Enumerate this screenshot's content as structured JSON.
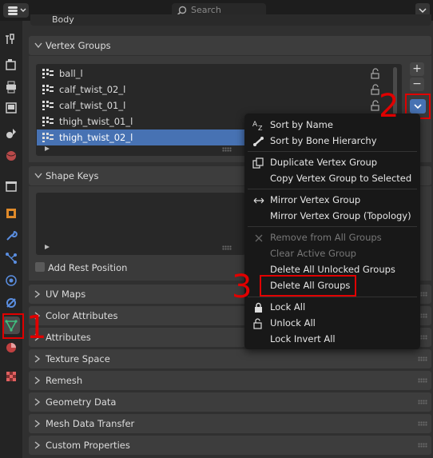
{
  "topbar": {
    "search_placeholder": "Search"
  },
  "header": {
    "object_name_partial": "Body"
  },
  "panels": {
    "vertex_groups": {
      "title": "Vertex Groups",
      "items": [
        {
          "label": "ball_l",
          "selected": false
        },
        {
          "label": "calf_twist_02_l",
          "selected": false
        },
        {
          "label": "calf_twist_01_l",
          "selected": false
        },
        {
          "label": "thigh_twist_01_l",
          "selected": false
        },
        {
          "label": "thigh_twist_02_l",
          "selected": true
        }
      ],
      "add_label": "+",
      "remove_label": "−"
    },
    "shape_keys": {
      "title": "Shape Keys",
      "add_rest_position": "Add Rest Position"
    },
    "collapsed": [
      "UV Maps",
      "Color Attributes",
      "Attributes",
      "Texture Space",
      "Remesh",
      "Geometry Data",
      "Mesh Data Transfer",
      "Custom Properties"
    ]
  },
  "context_menu": {
    "items": [
      {
        "label": "Sort by Name",
        "icon": "sort-alpha-icon",
        "enabled": true
      },
      {
        "label": "Sort by Bone Hierarchy",
        "icon": "bone-icon",
        "enabled": true
      },
      {
        "label": "Duplicate Vertex Group",
        "icon": "duplicate-icon",
        "enabled": true
      },
      {
        "label": "Copy Vertex Group to Selected",
        "icon": "",
        "enabled": true
      },
      {
        "label": "Mirror Vertex Group",
        "icon": "mirror-arrows-icon",
        "enabled": true
      },
      {
        "label": "Mirror Vertex Group (Topology)",
        "icon": "",
        "enabled": true
      },
      {
        "label": "Remove from All Groups",
        "icon": "x-icon",
        "enabled": false
      },
      {
        "label": "Clear Active Group",
        "icon": "",
        "enabled": false
      },
      {
        "label": "Delete All Unlocked Groups",
        "icon": "",
        "enabled": true
      },
      {
        "label": "Delete All Groups",
        "icon": "",
        "enabled": true
      },
      {
        "label": "Lock All",
        "icon": "lock-closed-icon",
        "enabled": true
      },
      {
        "label": "Unlock All",
        "icon": "lock-open-icon",
        "enabled": true
      },
      {
        "label": "Lock Invert All",
        "icon": "",
        "enabled": true
      }
    ]
  },
  "annotations": {
    "step1": "1",
    "step2": "2",
    "step3": "3"
  },
  "colors": {
    "accent": "#4772b3",
    "annotation": "#e00000",
    "data_tab_green": "#3fbf7f"
  }
}
